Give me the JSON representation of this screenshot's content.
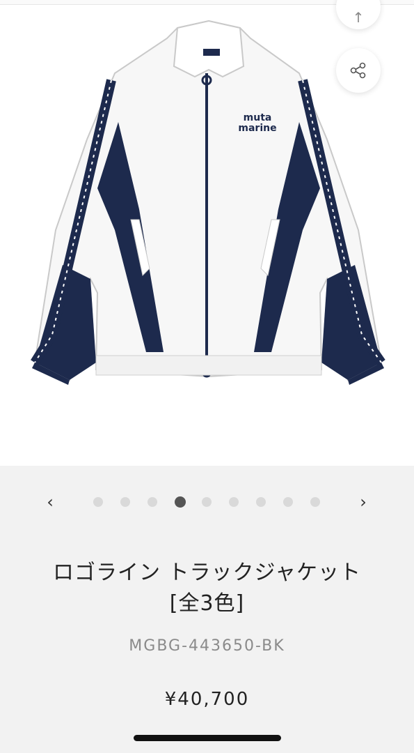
{
  "product": {
    "title_line1": "ロゴライン トラックジャケット",
    "title_line2": "[全3色]",
    "code": "MGBG-443650-BK",
    "price": "¥40,700",
    "jacket_logo": "muta marine"
  },
  "carousel": {
    "prev_label": "‹",
    "next_label": "›",
    "dot_count": 9,
    "active_index": 3
  },
  "icons": {
    "share": "share-icon",
    "top": "arrow-up-icon"
  },
  "colors": {
    "navy": "#1d2a4d",
    "dot_active": "#555555",
    "dot_inactive": "#d9d9d9"
  }
}
